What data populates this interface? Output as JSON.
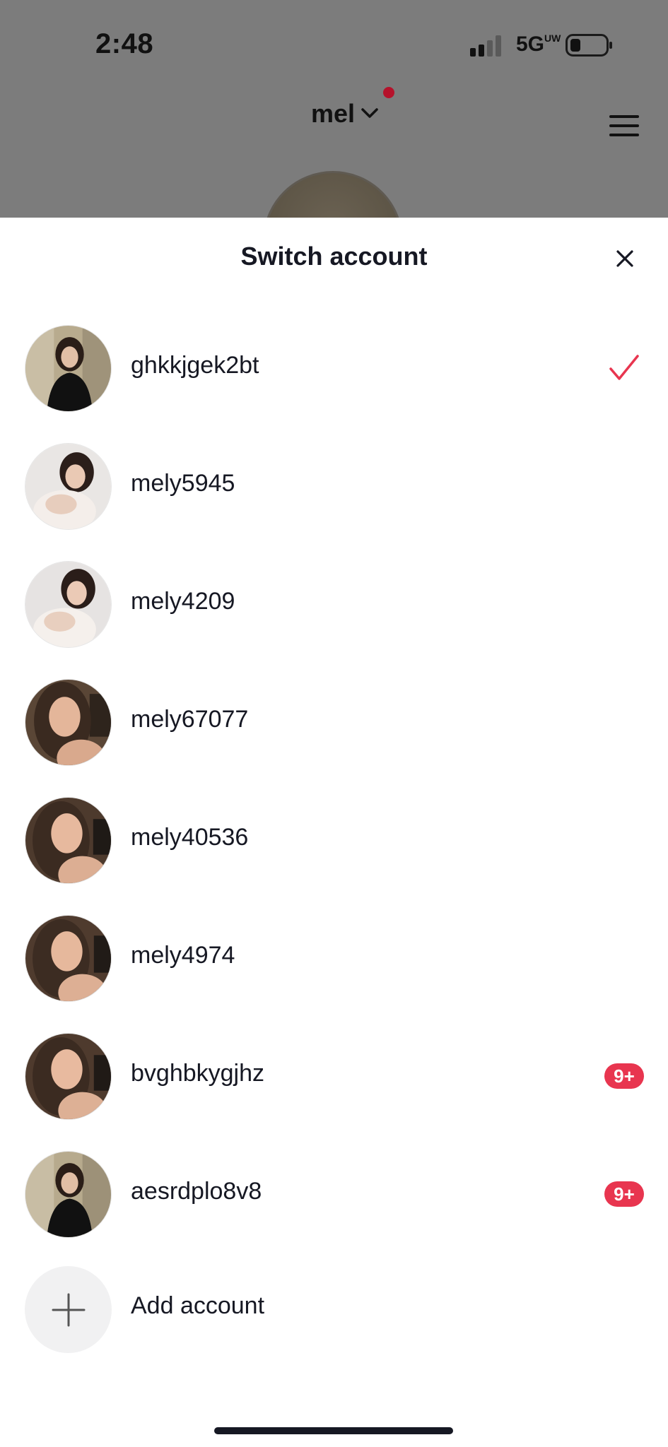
{
  "status_bar": {
    "time": "2:48",
    "network": "5G",
    "network_suffix": "UW"
  },
  "profile_header": {
    "username": "mel",
    "icons": [
      "chevron-down-icon",
      "notification-dot",
      "menu-icon"
    ]
  },
  "sheet": {
    "title": "Switch account",
    "close_icon": "close-icon",
    "accounts": [
      {
        "username": "ghkkjgek2bt",
        "selected": true,
        "badge": ""
      },
      {
        "username": "mely5945",
        "selected": false,
        "badge": ""
      },
      {
        "username": "mely4209",
        "selected": false,
        "badge": ""
      },
      {
        "username": "mely67077",
        "selected": false,
        "badge": ""
      },
      {
        "username": "mely40536",
        "selected": false,
        "badge": ""
      },
      {
        "username": "mely4974",
        "selected": false,
        "badge": ""
      },
      {
        "username": "bvghbkygjhz",
        "selected": false,
        "badge": "9+"
      },
      {
        "username": "aesrdplo8v8",
        "selected": false,
        "badge": "9+"
      }
    ],
    "add_account_label": "Add account"
  },
  "colors": {
    "accent": "#e8354f",
    "dim_overlay": "#7c7c7c",
    "text": "#161823"
  }
}
